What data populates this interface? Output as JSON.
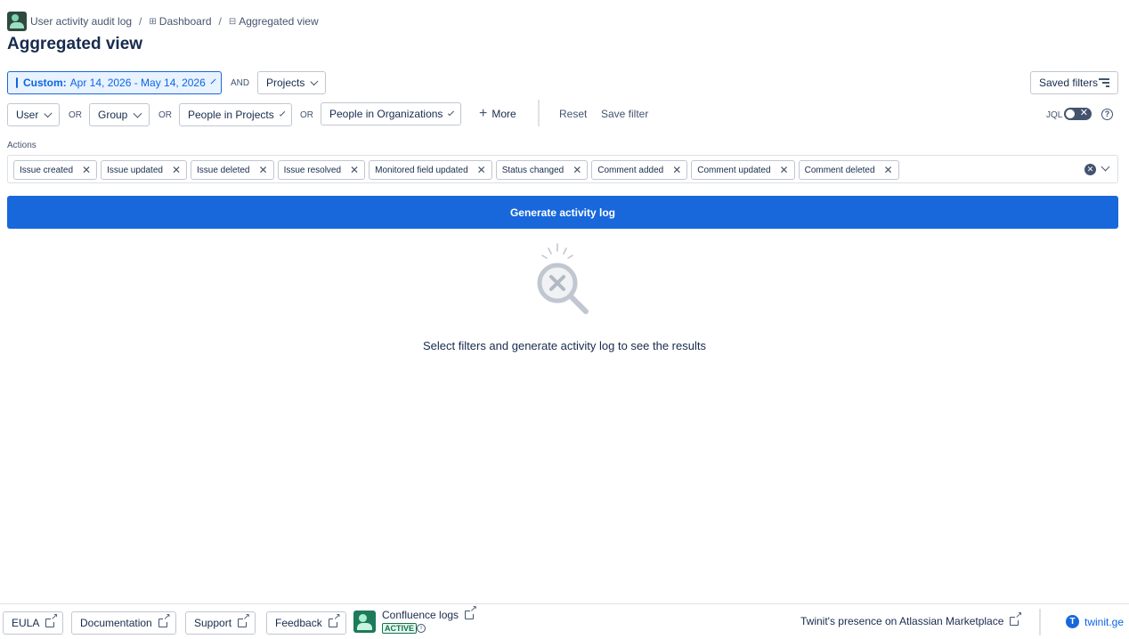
{
  "breadcrumb": {
    "app": "User activity audit log",
    "dashboard": "Dashboard",
    "current": "Aggregated view"
  },
  "page_title": "Aggregated view",
  "filters": {
    "date_prefix": "Custom:",
    "date_range": "Apr 14, 2026 - May 14, 2026",
    "and_label": "AND",
    "projects": "Projects",
    "saved_filters": "Saved filters",
    "user": "User",
    "or_label": "OR",
    "group": "Group",
    "people_in_projects": "People in Projects",
    "people_in_organizations": "People in Organizations",
    "more": "More",
    "reset": "Reset",
    "save_filter": "Save filter",
    "jql": "JQL"
  },
  "actions": {
    "label": "Actions",
    "tags": [
      "Issue created",
      "Issue updated",
      "Issue deleted",
      "Issue resolved",
      "Monitored field updated",
      "Status changed",
      "Comment added",
      "Comment updated",
      "Comment deleted"
    ]
  },
  "generate_button": "Generate activity log",
  "empty_state": "Select filters and generate activity log to see the results",
  "footer": {
    "eula": "EULA",
    "documentation": "Documentation",
    "support": "Support",
    "feedback": "Feedback",
    "confluence_logs": "Confluence logs",
    "status_badge": "ACTIVE",
    "marketplace": "Twinit's presence on Atlassian Marketplace",
    "twinit": "twinit.ge"
  },
  "colors": {
    "primary": "#1868db",
    "active_badge": "#216e4e",
    "text": "#172b4d"
  }
}
